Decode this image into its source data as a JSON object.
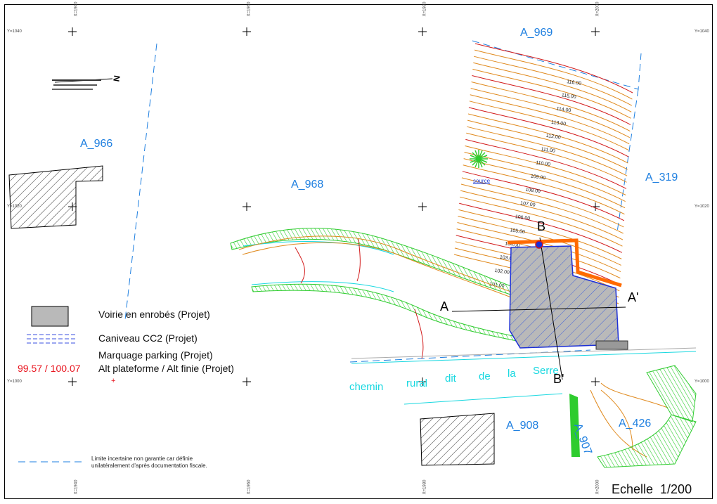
{
  "parcels": {
    "a969": "A_969",
    "a966": "A_966",
    "a968": "A_968",
    "a319": "A_319",
    "a908": "A_908",
    "a907": "A_907",
    "a426": "A_426"
  },
  "sections": {
    "a": "A",
    "a_prime": "A'",
    "b": "B",
    "b_prime": "B'"
  },
  "road": {
    "words": [
      "chemin",
      "rural",
      "dit",
      "de",
      "la",
      "Serre"
    ]
  },
  "spring_label": "source",
  "contours": [
    "116.00",
    "115.00",
    "114.00",
    "113.00",
    "112.00",
    "111.00",
    "110.00",
    "109.00",
    "108.00",
    "107.00",
    "106.00",
    "105.00",
    "104.00",
    "103.00",
    "102.00",
    "101.00"
  ],
  "legend": {
    "voirie": "Voirie en enrobés (Projet)",
    "caniveau": "Caniveau CC2 (Projet)",
    "marquage": "Marquage parking (Projet)",
    "alt_values": "99.57 / 100.07",
    "alt_label": "Alt plateforme / Alt finie (Projet)"
  },
  "note": {
    "line1": "Limite incertaine non garantie car définie",
    "line2": "unilatéralement d'après documentation fiscale."
  },
  "scale": "Echelle  1/200",
  "grid": {
    "x_labels": [
      "X=1940",
      "X=1960",
      "X=1980",
      "X=2000"
    ],
    "y_labels": [
      "Y=1040",
      "Y=1020",
      "Y=1000"
    ]
  },
  "colors": {
    "parcel_text": "#1e7fe0",
    "contour_orange": "#e08a1e",
    "contour_red": "#d21a1a",
    "hatch_green": "#2ecc2e",
    "road_cyan": "#18d8e0",
    "paving_gray": "#b9b9b9",
    "gutter_blue": "#1c2fd6"
  }
}
